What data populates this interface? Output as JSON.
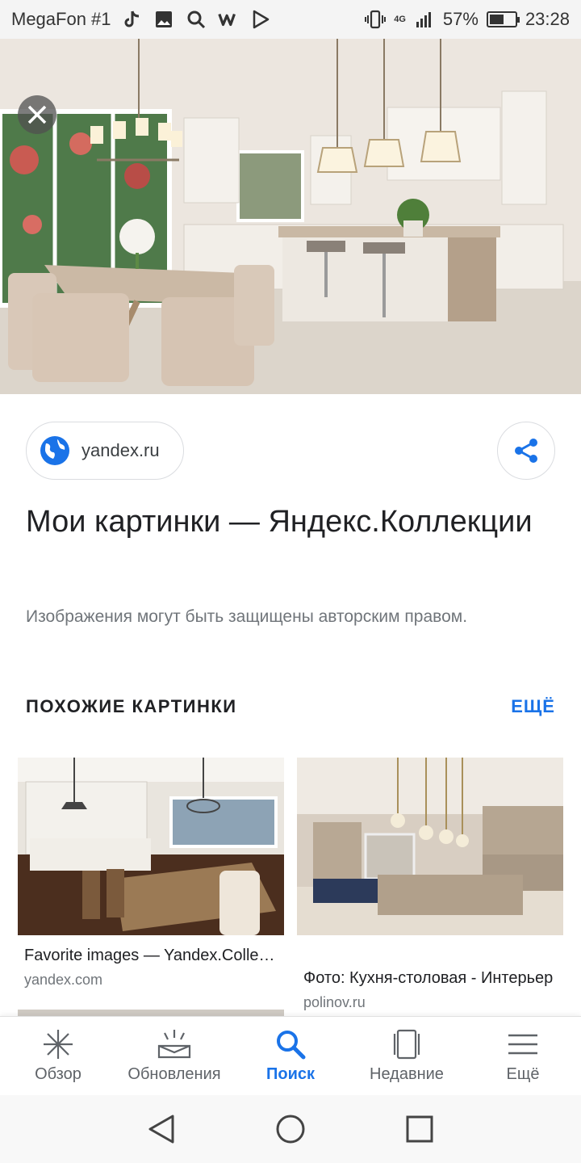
{
  "status_bar": {
    "carrier": "MegaFon #1",
    "network": "4G",
    "battery": "57%",
    "battery_level": 0.57,
    "time": "23:28",
    "icons": [
      "tiktok-icon",
      "gallery-icon",
      "search-icon",
      "w-app-icon",
      "play-store-icon",
      "vibrate-icon",
      "signal-icon"
    ]
  },
  "hero": {
    "image": "kitchen-dining-room-photo"
  },
  "source": {
    "domain": "yandex.ru"
  },
  "title": "Мои картинки — Яндекс.Коллекции",
  "copyright": "Изображения могут быть защищены авторским правом.",
  "similar": {
    "header": "ПОХОЖИЕ КАРТИНКИ",
    "more": "ЕЩЁ",
    "cards": [
      {
        "title": "Favorite images — Yandex.Collections",
        "domain": "yandex.com"
      },
      {
        "title": "Фото: Кухня-столовая - Интерьер",
        "domain": "polinov.ru"
      }
    ]
  },
  "bottom_nav": {
    "items": [
      {
        "label": "Обзор",
        "icon": "discover-icon"
      },
      {
        "label": "Обновления",
        "icon": "updates-icon"
      },
      {
        "label": "Поиск",
        "icon": "search-icon",
        "active": true
      },
      {
        "label": "Недавние",
        "icon": "recent-icon"
      },
      {
        "label": "Ещё",
        "icon": "menu-icon"
      }
    ]
  },
  "colors": {
    "accent": "#1a73e8",
    "text": "#202124",
    "secondary": "#70757a"
  }
}
